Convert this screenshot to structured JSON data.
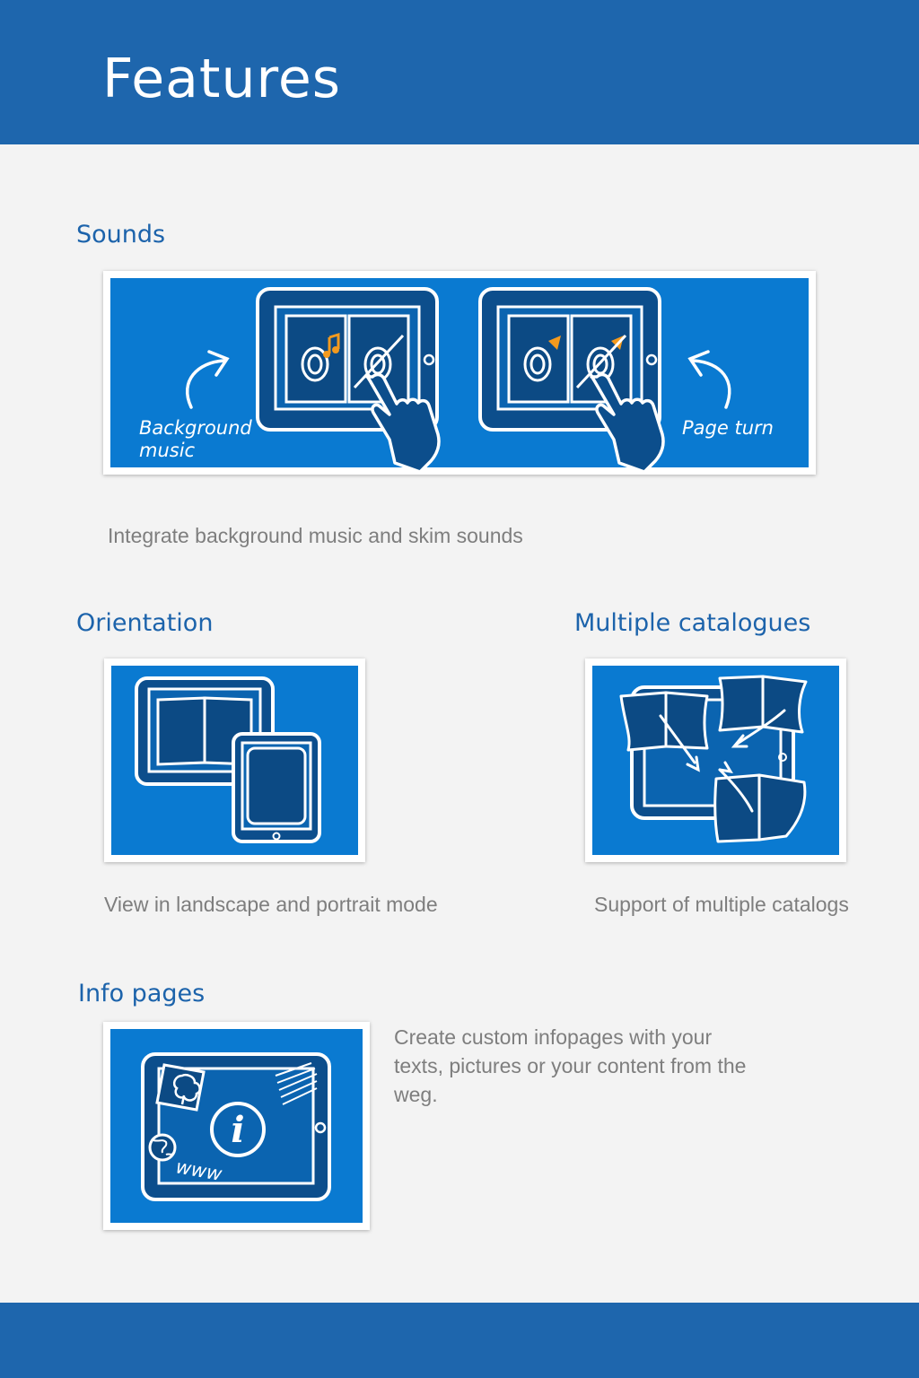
{
  "header": {
    "title": "Features"
  },
  "sections": {
    "sounds": {
      "title": "Sounds",
      "caption": "Integrate background music and skim sounds",
      "illustration": {
        "left_label_line1": "Background",
        "left_label_line2": "music",
        "right_label": "Page turn"
      }
    },
    "orientation": {
      "title": "Orientation",
      "caption": "View in landscape and portrait mode"
    },
    "catalogues": {
      "title": "Multiple catalogues",
      "caption": "Support of multiple catalogs"
    },
    "info": {
      "title": "Info pages",
      "caption_lines": [
        "Create custom infopages with your",
        "texts, pictures or your content from the",
        "weg."
      ],
      "illustration": {
        "badge_letter": "i",
        "web_label": "www"
      }
    }
  },
  "colors": {
    "brand_blue": "#1e66ad",
    "illustration_blue": "#0a7ad1",
    "title_blue": "#1c63ab",
    "caption_gray": "#7e7e7e",
    "page_background": "#f3f3f3",
    "music_note_accent": "#f39a1e"
  },
  "icons": [
    "music-note-icon",
    "speaker-icon",
    "hand-pointer-icon",
    "curved-arrow-icon",
    "tablet-icon",
    "book-icon",
    "info-icon",
    "globe-icon",
    "tree-picture-icon"
  ]
}
